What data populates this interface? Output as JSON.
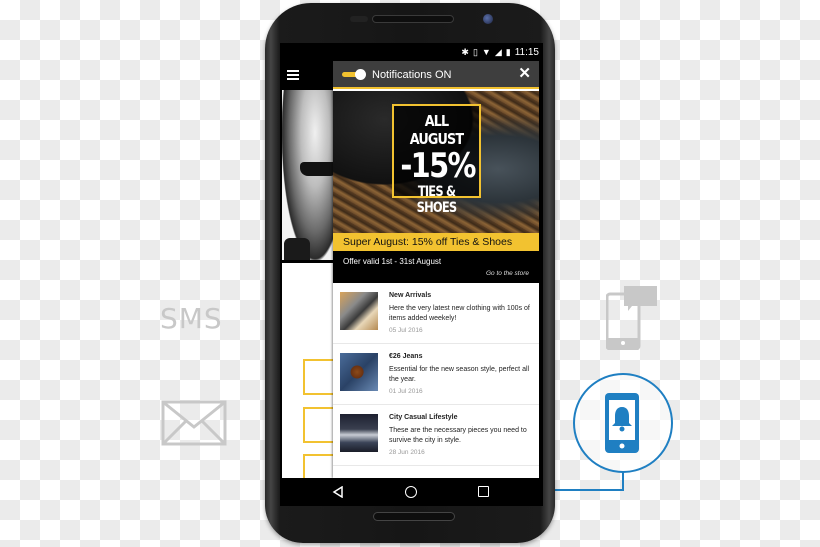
{
  "background": {
    "sms_label": "SMS",
    "icons": [
      "mail-icon",
      "chat-phone-icon",
      "notification-phone-icon"
    ],
    "accent_color": "#1f7fc2"
  },
  "statusbar": {
    "icons": [
      "bluetooth-icon",
      "vibrate-icon",
      "wifi-icon",
      "signal-icon",
      "battery-icon"
    ],
    "time": "11:15"
  },
  "app": {
    "menu_icon": "hamburger-icon"
  },
  "notification_panel": {
    "toggle_state": "on",
    "title": "Notifications ON",
    "close_label": "✕",
    "accent_color": "#f2c230",
    "banner": {
      "line1": "ALL AUGUST",
      "line2": "-15%",
      "line3": "TIES & SHOES"
    },
    "promo_title": "Super August: 15% off Ties & Shoes",
    "offer_valid": "Offer valid 1st - 31st August",
    "cta": "Go to the store",
    "items": [
      {
        "title": "New Arrivals",
        "description": "Here the very latest new clothing with 100s of items added weekely!",
        "date": "05 Jul 2016"
      },
      {
        "title": "€26 Jeans",
        "description": "Essential for the new season style, perfect all the year.",
        "date": "01 Jul 2016"
      },
      {
        "title": "City Casual Lifestyle",
        "description": "These are the necessary pieces you need to survive the city in style.",
        "date": "28 Jun 2016"
      }
    ]
  },
  "navbar": {
    "buttons": [
      "back",
      "home",
      "recents"
    ]
  }
}
